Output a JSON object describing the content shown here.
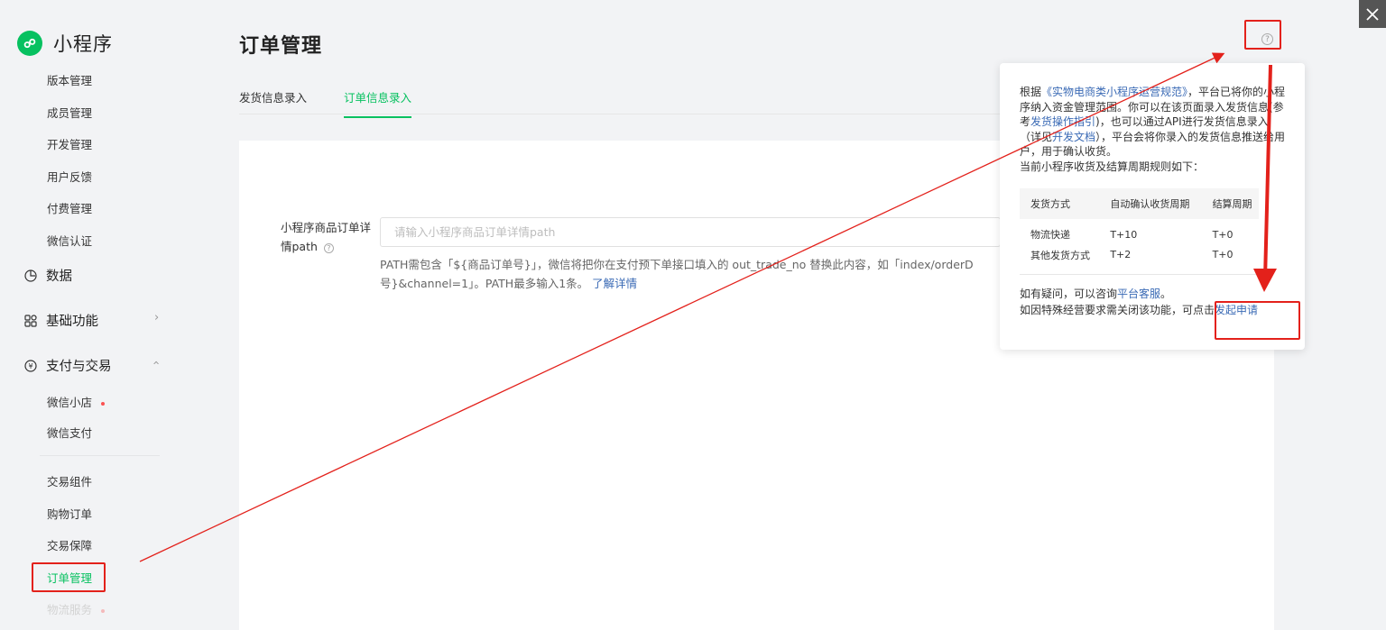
{
  "sidebar": {
    "brand": "小程序",
    "group1": [
      "版本管理",
      "成员管理",
      "开发管理",
      "用户反馈",
      "付费管理",
      "微信认证"
    ],
    "data_label": "数据",
    "basic_label": "基础功能",
    "pay_label": "支付与交易",
    "pay_items": [
      "微信小店",
      "微信支付"
    ],
    "trade_items": [
      "交易组件",
      "购物订单",
      "交易保障",
      "订单管理",
      "物流服务"
    ]
  },
  "main": {
    "title": "订单管理",
    "tabs": [
      "发货信息录入",
      "订单信息录入"
    ],
    "form": {
      "label": "小程序商品订单详情path",
      "placeholder": "请输入小程序商品订单详情path",
      "hint_line1": "PATH需包含「${商品订单号}」，微信将把你在支付预下单接口填入的 out_trade_no 替换此内容，如「index/orderD",
      "hint_line2": "号}&channel=1」。PATH最多输入1条。",
      "hint_link": "了解详情"
    }
  },
  "popover": {
    "p1_a": "根据",
    "p1_link1": "《实物电商类小程序运营规范》",
    "p1_b": "，平台已将你的小程序纳入资金管理范围。你可以在该页面录入发货信息(参考",
    "p1_link2": "发货操作指引",
    "p1_c": ")，也可以通过API进行发货信息录入（详见",
    "p1_link3": "开发文档",
    "p1_d": "），平台会将你录入的发货信息推送给用户，用于确认收货。",
    "p1_e": "当前小程序收货及结算周期规则如下：",
    "table": {
      "headers": [
        "发货方式",
        "自动确认收货周期",
        "结算周期"
      ],
      "rows": [
        [
          "物流快递",
          "T+10",
          "T+0"
        ],
        [
          "其他发货方式",
          "T+2",
          "T+0"
        ]
      ]
    },
    "foot1_a": "如有疑问，可以咨询",
    "foot1_link": "平台客服",
    "foot1_b": "。",
    "foot2_a": "如因特殊经营要求需关闭该功能，可点击",
    "foot2_link": "发起申请"
  },
  "colors": {
    "accent": "#07c160",
    "link": "#3a6ab5",
    "annotation": "#e3211b"
  },
  "icons": {
    "close": "close-icon",
    "help": "help-icon",
    "brand": "mini-program-logo-icon"
  }
}
